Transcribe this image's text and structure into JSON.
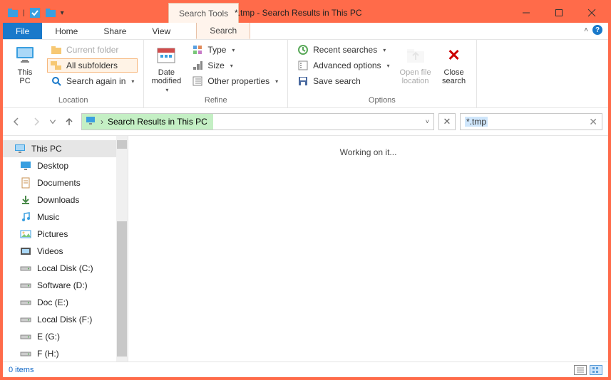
{
  "titlebar": {
    "context_tab": "Search Tools",
    "title": "*.tmp - Search Results in This PC"
  },
  "tabs": {
    "file": "File",
    "home": "Home",
    "share": "Share",
    "view": "View",
    "search": "Search"
  },
  "ribbon": {
    "location": {
      "label": "Location",
      "this_pc": "This\nPC",
      "current_folder": "Current folder",
      "all_subfolders": "All subfolders",
      "search_again": "Search again in"
    },
    "refine": {
      "label": "Refine",
      "date_modified": "Date\nmodified",
      "type": "Type",
      "size": "Size",
      "other_properties": "Other properties"
    },
    "options": {
      "label": "Options",
      "recent_searches": "Recent searches",
      "advanced_options": "Advanced options",
      "save_search": "Save search",
      "open_file_location": "Open file\nlocation",
      "close_search": "Close\nsearch"
    }
  },
  "address": {
    "path": "Search Results in This PC"
  },
  "search": {
    "query": "*.tmp"
  },
  "nav": {
    "this_pc": "This PC",
    "items": [
      "Desktop",
      "Documents",
      "Downloads",
      "Music",
      "Pictures",
      "Videos",
      "Local Disk (C:)",
      "Software (D:)",
      "Doc (E:)",
      "Local Disk (F:)",
      "E (G:)",
      "F (H:)"
    ]
  },
  "content": {
    "status_text": "Working on it..."
  },
  "status": {
    "item_count": "0 items"
  }
}
